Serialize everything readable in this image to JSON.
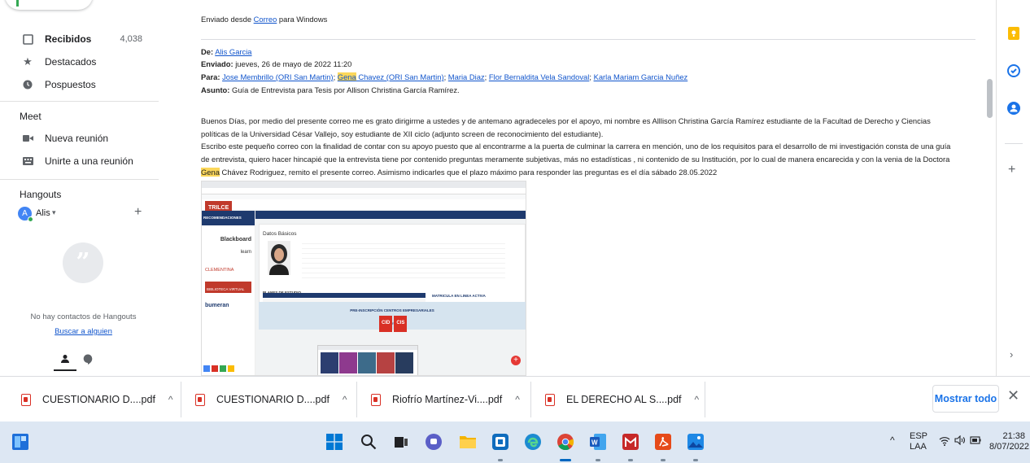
{
  "sidebar": {
    "items": [
      {
        "label": "Recibidos",
        "count": "4,038"
      },
      {
        "label": "Destacados"
      },
      {
        "label": "Pospuestos"
      }
    ],
    "meet_title": "Meet",
    "meet_items": [
      {
        "label": "Nueva reunión"
      },
      {
        "label": "Unirte a una reunión"
      }
    ],
    "hangouts_title": "Hangouts",
    "user_initial": "A",
    "user_name": "Alis",
    "no_contacts": "No hay contactos de Hangouts",
    "find_someone": "Buscar a alguien"
  },
  "email": {
    "sent_from_prefix": "Enviado desde ",
    "sent_from_link": "Correo",
    "sent_from_suffix": " para Windows",
    "from_label": "De:",
    "from_value": "Alis Garcia",
    "sent_label": "Enviado:",
    "sent_value": "jueves, 26 de mayo de 2022 11:20",
    "to_label": "Para:",
    "to_recipients": [
      "Jose Membrillo (ORI San Martin)",
      "Gena",
      " Chavez (ORI San Martin)",
      "Maria Diaz",
      "Flor Bernaldita Vela Sandoval",
      "Karla Mariam Garcia Nuñez"
    ],
    "subject_label": "Asunto:",
    "subject_value": "Guía de Entrevista para Tesis por Allison Christina García Ramírez.",
    "body_1": "Buenos Días, por medio del presente correo me es grato dirigirme a ustedes y de antemano agradeceles por el apoyo,  mi nombre es Alllison Christina García Ramírez estudiante de la Facultad de Derecho y Ciencias",
    "body_2": "políticas de la Universidad César Vallejo, soy estudiante de XII ciclo (adjunto screen de reconocimiento del estudiante).",
    "body_3": "Escribo este pequeño correo con la finalidad de contar con su apoyo puesto que al encontrarme a la puerta de culminar la carrera en mención, uno de los requisitos para el desarrollo de mi investigación consta de una guía",
    "body_4": "de entrevista, quiero hacer hincapié que la entrevista tiene por contenido preguntas meramente subjetivas, más no estadísticas , ni contenido de su Institución, por lo cual de manera encarecida y con la venia de la Doctora",
    "body_5_hl": "Gena",
    "body_5": " Chávez Rodriguez, remito el presente correo. Asimismo indicarles que el plazo máximo para responder las preguntas es el día sábado 28.05.2022"
  },
  "embedded": {
    "brand": "TRILCE",
    "section": "RECOMENDACIONES",
    "card_title": "Datos Básicos",
    "partners": [
      "Blackboard",
      "learn",
      "CLEMENTINA",
      "BIBLIOTECA VIRTUAL",
      "bumeran"
    ],
    "table_title": "PLANES DE ESTUDIO",
    "matricula": "MATRICULA EN LINEA ACTIVA",
    "pre_title": "PRE-INSCRIPCIÓN CENTROS EMPRESARIALES",
    "pre_sub": "PREGRADO",
    "btn_cid": "CID",
    "btn_cis": "CIS"
  },
  "downloads": {
    "items": [
      {
        "name": "CUESTIONARIO D....pdf"
      },
      {
        "name": "CUESTIONARIO D....pdf"
      },
      {
        "name": "Riofrío Martínez-Vi....pdf"
      },
      {
        "name": "EL DERECHO AL S....pdf"
      }
    ],
    "show_all": "Mostrar todo"
  },
  "taskbar": {
    "lang": "ESP",
    "layout": "LAA",
    "time": "21:38",
    "date": "8/07/2022"
  },
  "colors": {
    "link": "#1155cc",
    "highlight": "#fbd75b",
    "accent": "#1a73e8",
    "pdf_red": "#d93025",
    "taskbar": "#dde7f3"
  }
}
